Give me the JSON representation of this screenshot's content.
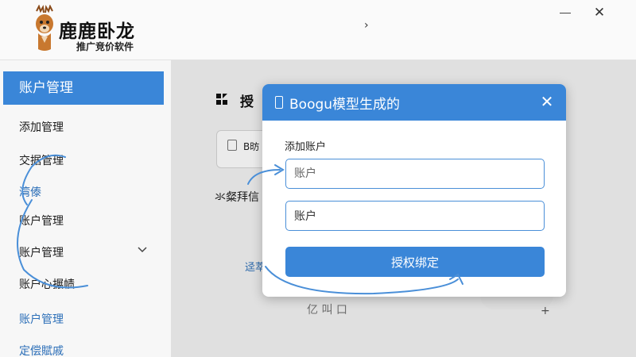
{
  "app": {
    "brand_name": "鹿鹿卧龙",
    "brand_sub": "推广竞价软件",
    "title_chevron": "›",
    "close_glyph": "✕"
  },
  "sidebar": {
    "active": "账户管理",
    "items": [
      {
        "label": "添加管理",
        "style": "dark"
      },
      {
        "label": "交据管理",
        "style": "dark"
      },
      {
        "label": "湾傣",
        "style": "blue"
      },
      {
        "label": "账户管理",
        "style": "dark"
      },
      {
        "label": "账户管理",
        "style": "dark"
      },
      {
        "label": "账户心搌帻",
        "style": "dark"
      },
      {
        "label": "账户管理",
        "style": "blue"
      },
      {
        "label": "定偿賦戚",
        "style": "blue"
      }
    ]
  },
  "main": {
    "title": "授",
    "card_text": "B昉",
    "label": "氺粲拜信",
    "link": "迳萃",
    "ghost": "亿  叫  口",
    "plus": "+"
  },
  "dialog": {
    "title": "Boogu模型生成的",
    "close": "✕",
    "section_label": "添加账户",
    "field1_placeholder": "账户",
    "field2_value": "账户",
    "button_label": "授权绑定"
  },
  "colors": {
    "accent": "#3a86d8",
    "annotation": "#4a8fd8"
  }
}
